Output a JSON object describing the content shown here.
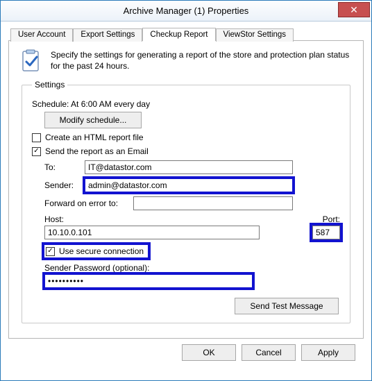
{
  "window": {
    "title": "Archive Manager (1) Properties",
    "close_glyph": "✕"
  },
  "tabs": {
    "user_account": "User Account",
    "export_settings": "Export Settings",
    "checkup_report": "Checkup Report",
    "viewstor_settings": "ViewStor Settings"
  },
  "intro": "Specify the settings for generating a report of the store and protection plan status for the past 24 hours.",
  "settings": {
    "legend": "Settings",
    "schedule_label": "Schedule: At 6:00 AM every day",
    "modify_btn": "Modify schedule...",
    "html_checkbox_label": "Create an HTML report file",
    "html_checked": false,
    "email_checkbox_label": "Send the report as an Email",
    "email_checked": true,
    "to_label": "To:",
    "to_value": "IT@datastor.com",
    "sender_label": "Sender:",
    "sender_value": "admin@datastor.com",
    "forward_label": "Forward on error to:",
    "forward_value": "",
    "host_label": "Host:",
    "host_value": "10.10.0.101",
    "port_label": "Port:",
    "port_value": "587",
    "secure_label": "Use secure connection",
    "secure_checked": true,
    "pw_label": "Sender Password (optional):",
    "pw_value": "••••••••••",
    "send_test_btn": "Send Test Message"
  },
  "buttons": {
    "ok": "OK",
    "cancel": "Cancel",
    "apply": "Apply"
  }
}
